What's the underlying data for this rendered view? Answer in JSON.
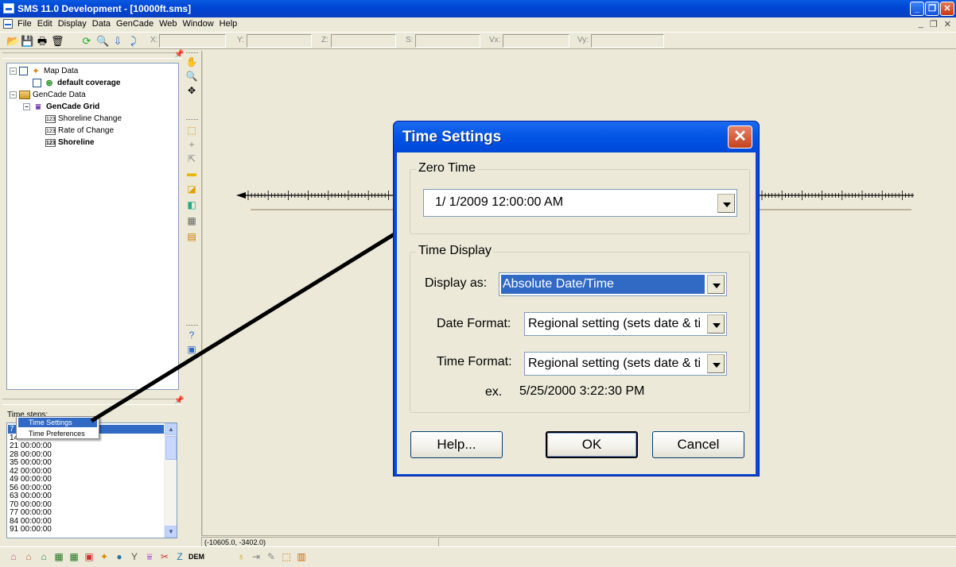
{
  "window": {
    "title": "SMS 11.0 Development - [10000ft.sms]"
  },
  "menu": [
    "File",
    "Edit",
    "Display",
    "Data",
    "GenCade",
    "Web",
    "Window",
    "Help"
  ],
  "toolbar": {
    "coord_labels": [
      "X:",
      "Y:",
      "Z:",
      "S:",
      "Vx:",
      "Vy:"
    ]
  },
  "tree": {
    "items": [
      {
        "label": "Map Data",
        "bold": false
      },
      {
        "label": "default coverage",
        "bold": true
      },
      {
        "label": "GenCade Data",
        "bold": false
      },
      {
        "label": "GenCade Grid",
        "bold": true
      },
      {
        "label": "Shoreline Change",
        "bold": false
      },
      {
        "label": "Rate of Change",
        "bold": false
      },
      {
        "label": "Shoreline",
        "bold": true
      }
    ]
  },
  "time_steps": {
    "label": "Time steps:",
    "items": [
      "7",
      "14",
      "21 00:00:00",
      "28 00:00:00",
      "35 00:00:00",
      "42 00:00:00",
      "49 00:00:00",
      "56 00:00:00",
      "63 00:00:00",
      "70 00:00:00",
      "77 00:00:00",
      "84 00:00:00",
      "91 00:00:00"
    ]
  },
  "context_menu": {
    "items": [
      "Time Settings",
      "Time Preferences"
    ],
    "selected": "Time Settings"
  },
  "status": {
    "coords": "(-10605.0, -3402.0)"
  },
  "bottom_toolbar": {
    "dem_label": "DEM"
  },
  "dialog": {
    "title": "Time Settings",
    "close_glyph": "✕",
    "zero_time": {
      "group_label": "Zero Time",
      "value": "1/  1/2009 12:00:00 AM"
    },
    "time_display": {
      "group_label": "Time Display",
      "display_as_label": "Display as:",
      "display_as_value": "Absolute Date/Time",
      "date_format_label": "Date Format:",
      "date_format_value": "Regional setting (sets date & ti",
      "time_format_label": "Time Format:",
      "time_format_value": "Regional setting (sets date & ti",
      "example_label": "ex.",
      "example_value": "5/25/2000 3:22:30 PM"
    },
    "buttons": {
      "help": "Help...",
      "ok": "OK",
      "cancel": "Cancel"
    }
  },
  "colors": {
    "titlebar": "#0054e3",
    "selection": "#316ac5",
    "dialog_face": "#ece9d8"
  }
}
